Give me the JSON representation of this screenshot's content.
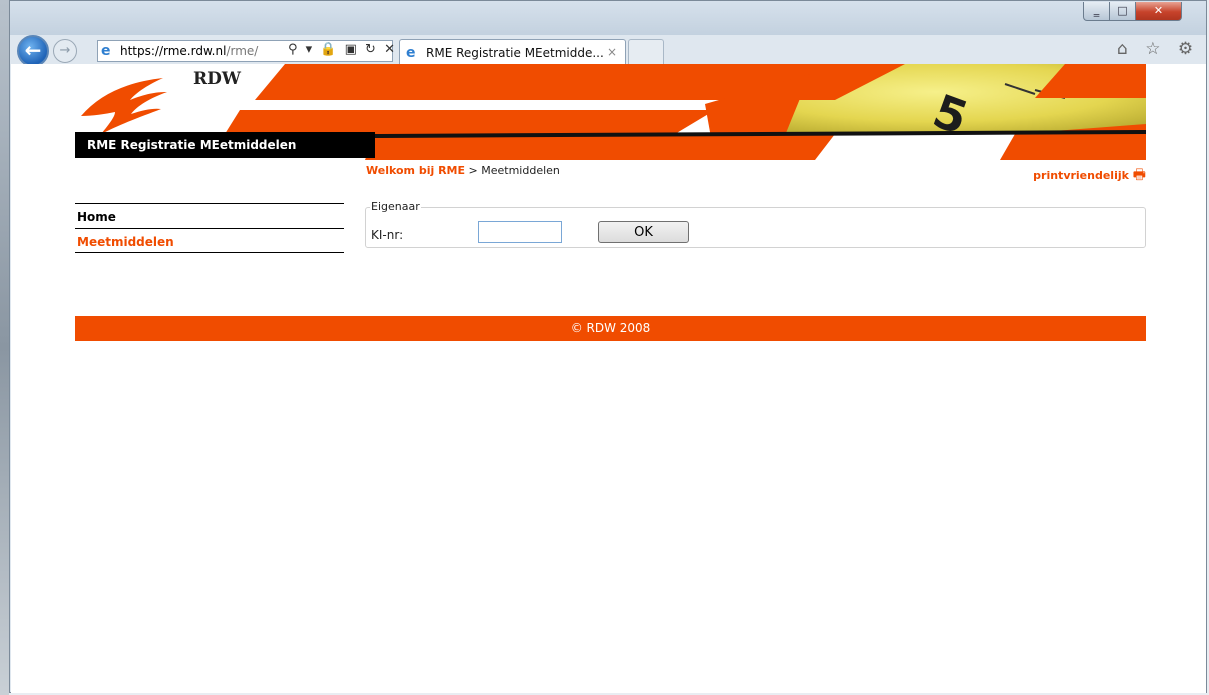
{
  "browser": {
    "url_scheme": "https://",
    "url_host": "rme.rdw.nl",
    "url_path": "/rme/",
    "tab_title": "RME Registratie MEetmidde...",
    "back_glyph": "←",
    "forward_glyph": "→",
    "close_glyph": "×",
    "address_tools": "⚲ ▾ 🔒 ▣ ↻ ✕",
    "right_icons": "⌂ ☆ ⚙",
    "window_min": "‗",
    "window_max": "□",
    "window_close": "✕"
  },
  "header": {
    "logo_text": "RDW",
    "site_title": "RME Registratie MEetmiddelen"
  },
  "breadcrumb": {
    "home_link": "Welkom bij RME",
    "separator": ">",
    "current": "Meetmiddelen"
  },
  "print_link": "printvriendelijk",
  "nav": {
    "items": [
      {
        "label": "Home"
      },
      {
        "label": "Meetmiddelen"
      }
    ]
  },
  "form": {
    "legend": "Eigenaar",
    "ki_label": "KI-nr:",
    "ki_value": "",
    "ok_label": "OK"
  },
  "footer": {
    "text": "© RDW 2008"
  },
  "colors": {
    "brand_orange": "#f04c00",
    "black": "#000000"
  },
  "icons": [
    "back-arrow-icon",
    "forward-arrow-icon",
    "ie-logo-icon",
    "search-icon",
    "lock-icon",
    "refresh-icon",
    "home-icon",
    "star-icon",
    "gear-icon",
    "printer-icon",
    "rdw-logo-icon"
  ]
}
